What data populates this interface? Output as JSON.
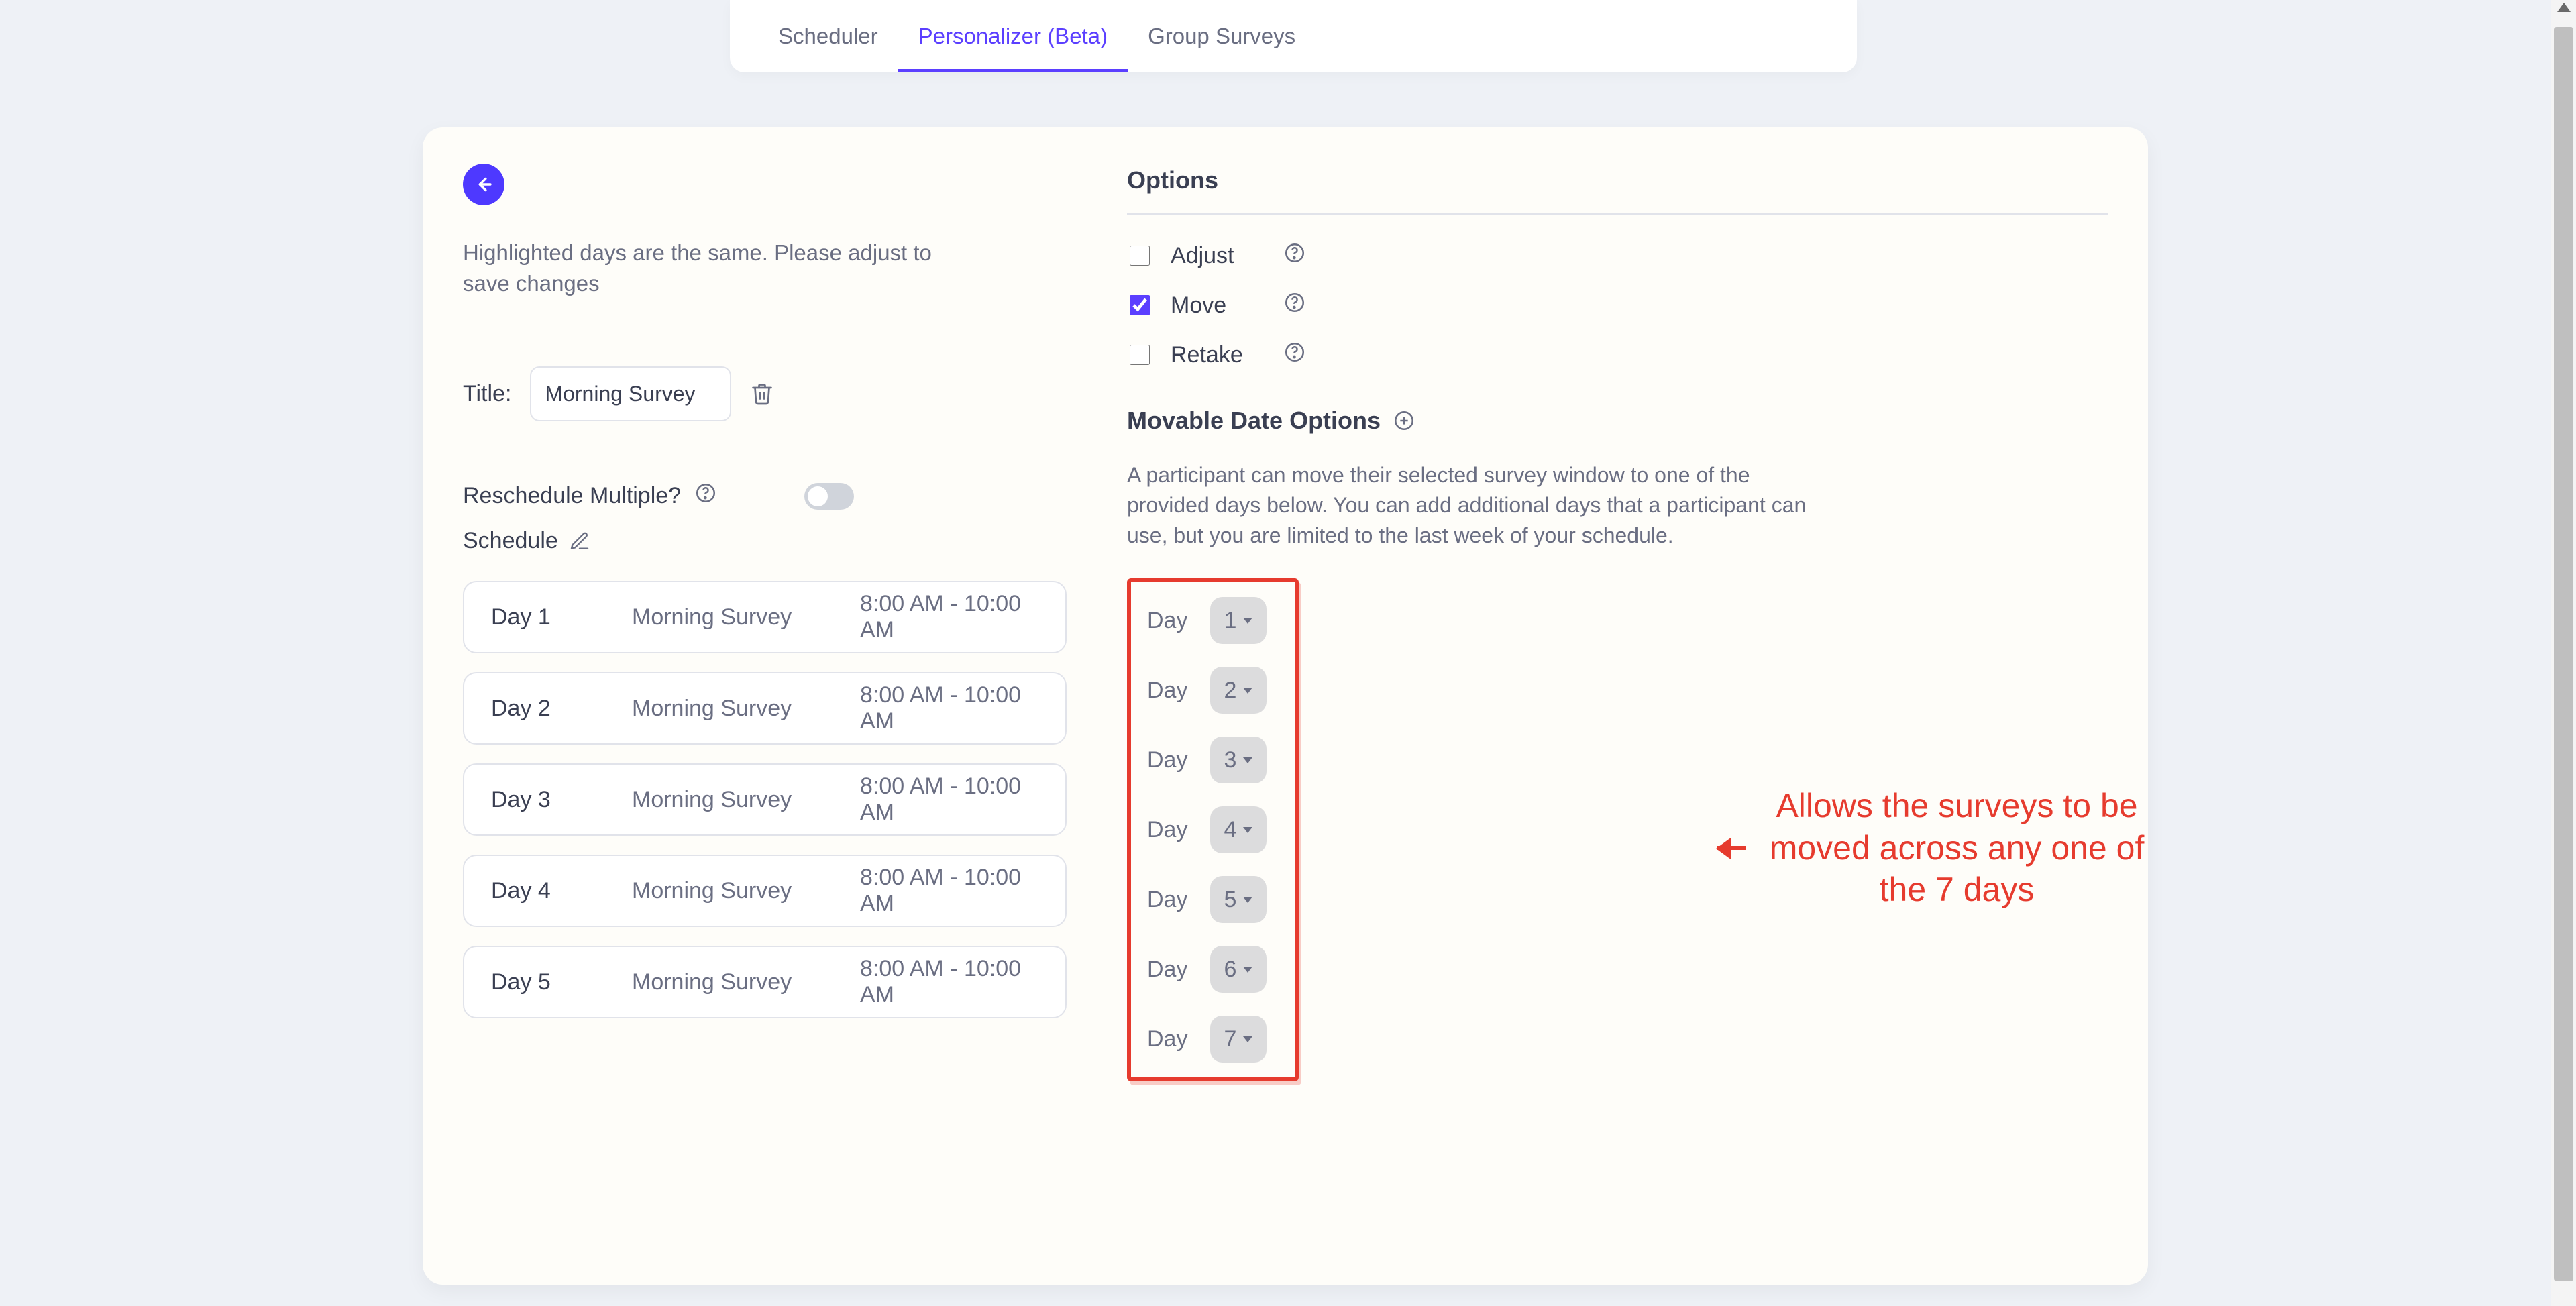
{
  "tabs": {
    "items": [
      {
        "label": "Scheduler",
        "active": false
      },
      {
        "label": "Personalizer (Beta)",
        "active": true
      },
      {
        "label": "Group Surveys",
        "active": false
      }
    ]
  },
  "left": {
    "warning": "Highlighted days are the same. Please adjust to save changes",
    "title_label": "Title:",
    "title_value": "Morning Survey",
    "reschedule_label": "Reschedule Multiple?",
    "reschedule_on": false,
    "schedule_label": "Schedule",
    "schedule": [
      {
        "dayLabel": "Day 1",
        "name": "Morning Survey",
        "time": "8:00 AM - 10:00 AM"
      },
      {
        "dayLabel": "Day 2",
        "name": "Morning Survey",
        "time": "8:00 AM - 10:00 AM"
      },
      {
        "dayLabel": "Day 3",
        "name": "Morning Survey",
        "time": "8:00 AM - 10:00 AM"
      },
      {
        "dayLabel": "Day 4",
        "name": "Morning Survey",
        "time": "8:00 AM - 10:00 AM"
      },
      {
        "dayLabel": "Day 5",
        "name": "Morning Survey",
        "time": "8:00 AM - 10:00 AM"
      }
    ]
  },
  "right": {
    "options_heading": "Options",
    "options": {
      "adjust": {
        "label": "Adjust",
        "checked": false
      },
      "move": {
        "label": "Move",
        "checked": true
      },
      "retake": {
        "label": "Retake",
        "checked": false
      }
    },
    "movable_heading": "Movable Date Options",
    "movable_description": "A participant can move their selected survey window to one of the provided days below. You can add additional days that a participant can use, but you are limited to the last week of your schedule.",
    "day_option_label": "Day",
    "day_option_values": [
      "1",
      "2",
      "3",
      "4",
      "5",
      "6",
      "7"
    ]
  },
  "annotation": {
    "text": "Allows the surveys to be moved across any one of the 7 days"
  },
  "colors": {
    "accent": "#5b3fff",
    "annotation_red": "#e63b2e"
  },
  "icons": {
    "back": "arrow-left-icon",
    "trash": "trash-icon",
    "edit": "edit-icon",
    "help": "help-icon",
    "plus": "plus-circle-icon",
    "caret_down": "chevron-down-icon"
  }
}
